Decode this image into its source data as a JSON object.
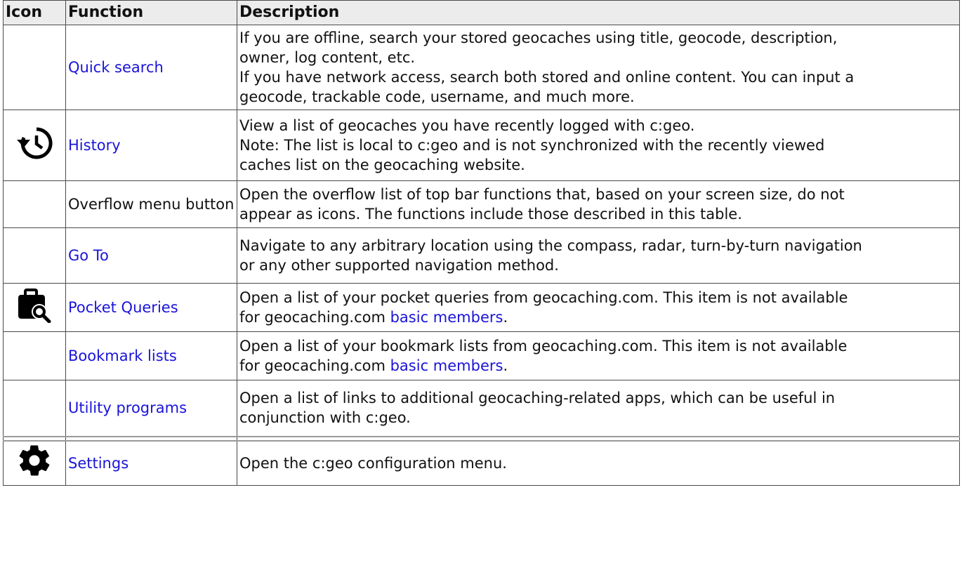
{
  "table": {
    "headers": [
      "Icon",
      "Function",
      "Description"
    ],
    "rows": [
      {
        "icon": "",
        "function": "Quick search",
        "function_is_link": true,
        "description": [
          "If you are offline, search your stored geocaches using title, geocode, description,",
          "owner, log content, etc.",
          "If you have network access, search both stored and online content. You can input a",
          "geocode, trackable code, username, and much more."
        ]
      },
      {
        "icon": "history-icon",
        "function": "History",
        "function_is_link": true,
        "description": [
          "View a list of geocaches you have recently logged with c:geo.",
          "Note: The list is local to c:geo and is not synchronized with the recently viewed",
          "caches list on the geocaching website."
        ]
      },
      {
        "icon": "",
        "function": "Overflow menu button",
        "function_is_link": false,
        "description": [
          "Open the overflow list of top bar functions that, based on your screen size, do not",
          "appear as icons. The functions include those described in this table."
        ]
      },
      {
        "icon": "",
        "function": "Go To",
        "function_is_link": true,
        "description": [
          "Navigate to any arbitrary location using the compass, radar, turn-by-turn navigation",
          "or any other supported navigation method."
        ]
      },
      {
        "icon": "pocket-query-search-icon",
        "function": "Pocket Queries",
        "function_is_link": true,
        "description_prefix": "Open a list of your pocket queries from geocaching.com. This item is not available",
        "description_line2_prefix": "for geocaching.com ",
        "description_link": "basic members",
        "description_suffix": "."
      },
      {
        "icon": "",
        "function": "Bookmark lists",
        "function_is_link": true,
        "description_prefix": "Open a list of your bookmark lists from geocaching.com. This item is not available",
        "description_line2_prefix": "for geocaching.com ",
        "description_link": "basic members",
        "description_suffix": "."
      },
      {
        "icon": "",
        "function": "Utility programs",
        "function_is_link": true,
        "description": [
          "Open a list of links to additional geocaching-related apps, which can be useful in",
          "conjunction with c:geo."
        ]
      },
      {
        "icon": "gear-icon",
        "function": "Settings",
        "function_is_link": true,
        "description": [
          "Open the c:geo configuration menu."
        ]
      }
    ]
  },
  "colors": {
    "link": "#1a14d8",
    "header_bg": "#ececec",
    "border": "#4a4a4a"
  }
}
